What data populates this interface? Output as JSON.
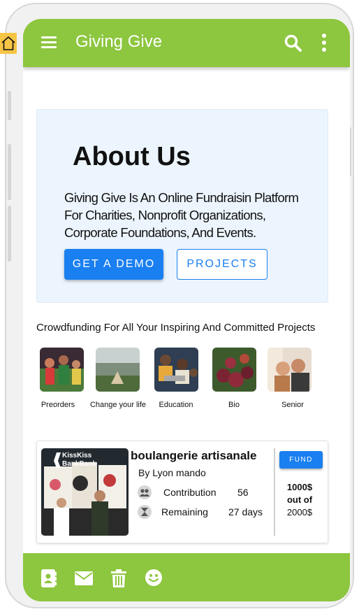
{
  "app": {
    "title": "Giving Give",
    "accent_color": "#8dc63f",
    "primary_color": "#1a7ff0"
  },
  "topbar": {
    "icons": [
      "menu-icon",
      "search-icon",
      "more-vertical-icon"
    ]
  },
  "about": {
    "title": "About Us",
    "text": "Giving Give Is An Online Fundraisin Platform For Charities, Nonprofit Organizations, Corporate Foundations, And Events.",
    "demo_button": "GET A DEMO",
    "projects_button": "PROJECTS"
  },
  "categories_heading": "Crowdfunding For All Your Inspiring And Committed Projects",
  "categories": [
    {
      "label": "Preorders"
    },
    {
      "label": "Change your life"
    },
    {
      "label": "Education"
    },
    {
      "label": "Bio"
    },
    {
      "label": "Senior"
    }
  ],
  "project": {
    "name": "boulangerie artisanale",
    "author": "By Lyon mando",
    "image_sign_text": "KissKiss BankBank",
    "contribution_label": "Contribution",
    "contribution_value": "56",
    "remaining_label": "Remaining",
    "remaining_value": "27 days",
    "fund_button": "FUND",
    "goal_amount": "1000$",
    "goal_out_of": "out of",
    "goal_total": "2000$"
  },
  "bottombar": {
    "icons": [
      "contacts-icon",
      "mail-icon",
      "trash-icon",
      "smiley-icon"
    ]
  }
}
